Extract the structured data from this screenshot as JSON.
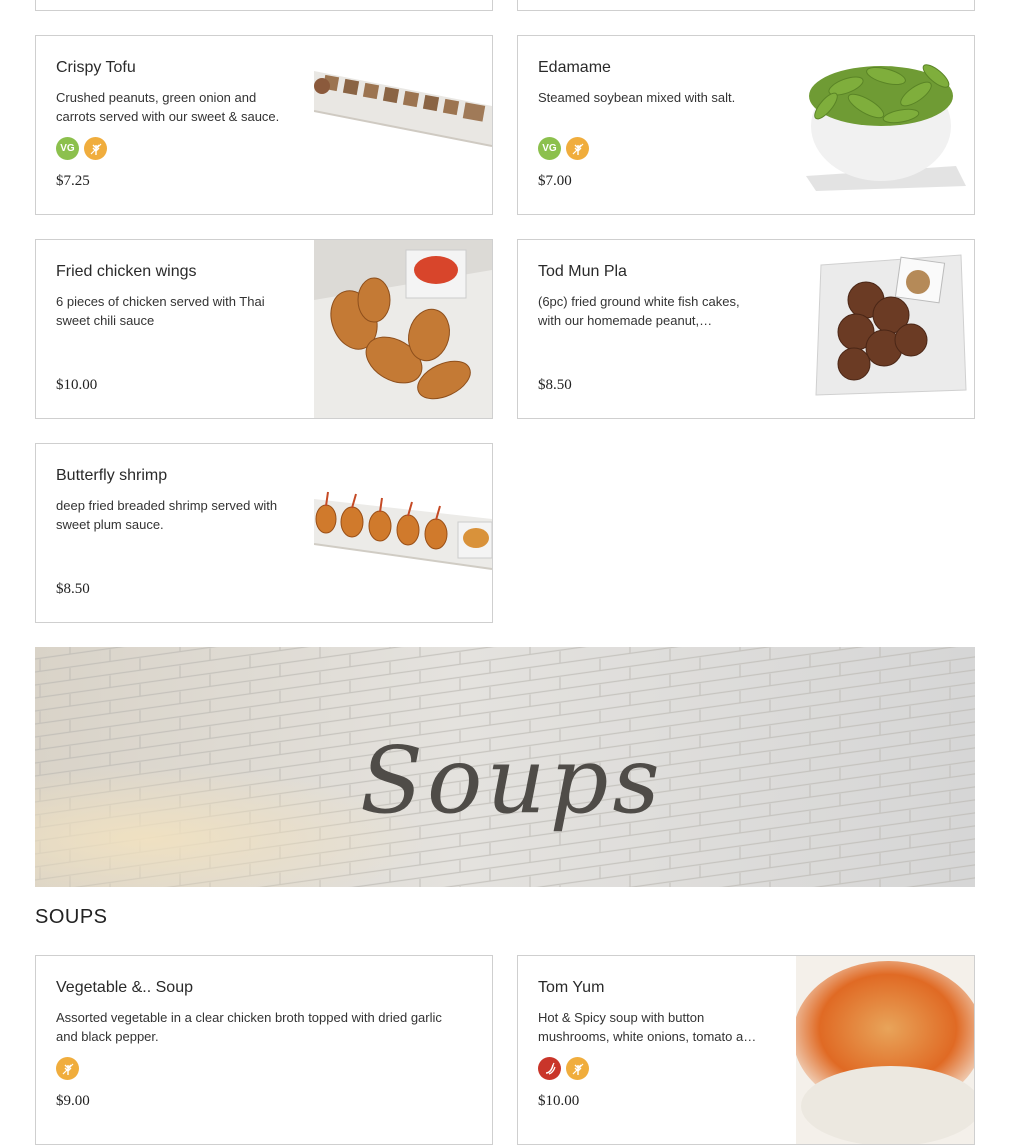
{
  "items": [
    {
      "title": "Crispy Tofu",
      "desc": "Crushed peanuts, green onion and carrots served with our sweet & sauce.",
      "price": "$7.25",
      "badges": [
        {
          "type": "vg",
          "label": "VG"
        },
        {
          "type": "gf",
          "label": ""
        }
      ],
      "photo": "fried-tofu-photo"
    },
    {
      "title": "Edamame",
      "desc": "Steamed soybean mixed with salt.",
      "price": "$7.00",
      "badges": [
        {
          "type": "vg",
          "label": "VG"
        },
        {
          "type": "gf",
          "label": ""
        }
      ],
      "photo": "edamame-photo"
    },
    {
      "title": "Fried chicken wings",
      "desc": "6 pieces of chicken served with Thai sweet chili sauce",
      "price": "$10.00",
      "badges": [],
      "photo": "chicken-wings-photo"
    },
    {
      "title": "Tod Mun Pla",
      "desc": "(6pc) fried ground white fish cakes, with our homemade peanut,…",
      "price": "$8.50",
      "badges": [],
      "photo": "fish-cakes-photo"
    },
    {
      "title": "Butterfly shrimp",
      "desc": "deep fried breaded shrimp served with sweet plum sauce.",
      "price": "$8.50",
      "badges": [],
      "photo": "butterfly-shrimp-photo"
    },
    {
      "title": "Vegetable &.. Soup",
      "desc": "Assorted vegetable in a clear chicken broth topped with dried garlic and black pepper.",
      "price": "$9.00",
      "badges": [
        {
          "type": "gf",
          "label": ""
        }
      ],
      "photo": ""
    },
    {
      "title": "Tom Yum",
      "desc": "Hot & Spicy soup with button mushrooms, white onions, tomato a…",
      "price": "$10.00",
      "badges": [
        {
          "type": "sp",
          "label": ""
        },
        {
          "type": "gf",
          "label": ""
        }
      ],
      "photo": "tom-yum-photo"
    }
  ],
  "banner": {
    "text": "Soups"
  },
  "section": {
    "title": "SOUPS"
  },
  "colors": {
    "vegan": "#8cc04d",
    "gluten_free": "#f0ad3d",
    "spicy": "#c9352a",
    "border": "#cfcfcf"
  }
}
